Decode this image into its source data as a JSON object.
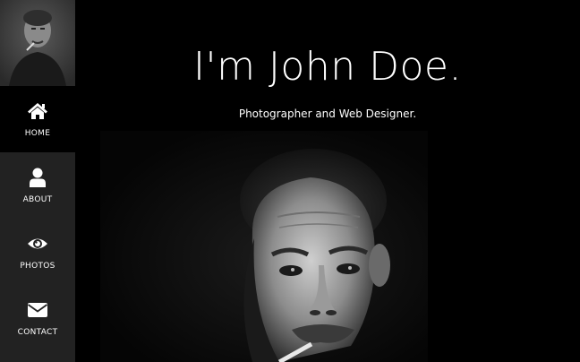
{
  "sidebar": {
    "avatar_alt": "avatar",
    "items": [
      {
        "label": "HOME",
        "icon": "home-icon",
        "active": true
      },
      {
        "label": "ABOUT",
        "icon": "user-icon",
        "active": false
      },
      {
        "label": "PHOTOS",
        "icon": "eye-icon",
        "active": false
      },
      {
        "label": "CONTACT",
        "icon": "envelope-icon",
        "active": false
      }
    ]
  },
  "hero": {
    "title": "I'm John Doe.",
    "subtitle": "Photographer and Web Designer."
  },
  "colors": {
    "sidebar_bg": "#222222",
    "active_bg": "#000000",
    "text": "#ffffff"
  }
}
